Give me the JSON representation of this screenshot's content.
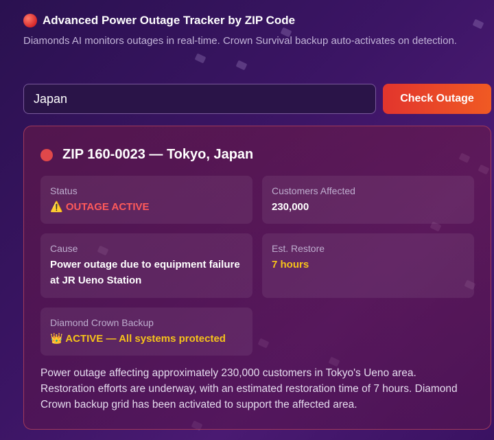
{
  "header": {
    "title": "Advanced Power Outage Tracker by ZIP Code",
    "subtitle": "Diamonds AI monitors outages in real-time. Crown Survival backup auto-activates on detection."
  },
  "search": {
    "value": "Japan",
    "button_label": "Check Outage"
  },
  "result": {
    "title": "ZIP 160-0023 — Tokyo, Japan",
    "tiles": {
      "status": {
        "label": "Status",
        "value": "⚠️ OUTAGE ACTIVE"
      },
      "customers": {
        "label": "Customers Affected",
        "value": "230,000"
      },
      "cause": {
        "label": "Cause",
        "value": "Power outage due to equipment failure at JR Ueno Station"
      },
      "restore": {
        "label": "Est. Restore",
        "value": "7 hours"
      },
      "backup": {
        "label": "Diamond Crown Backup",
        "value": "👑 ACTIVE — All systems protected"
      }
    },
    "summary": "Power outage affecting approximately 230,000 customers in Tokyo's Ueno area. Restoration efforts are underway, with an estimated restoration time of 7 hours. Diamond Crown backup grid has been activated to support the affected area."
  },
  "colors": {
    "accent_red": "#e0484a",
    "button_gradient_start": "#e2352d",
    "button_gradient_end": "#f05a23",
    "highlight_yellow": "#f6c21a"
  },
  "icons": {
    "title": "red-circle-icon",
    "status": "red-dot-icon"
  }
}
